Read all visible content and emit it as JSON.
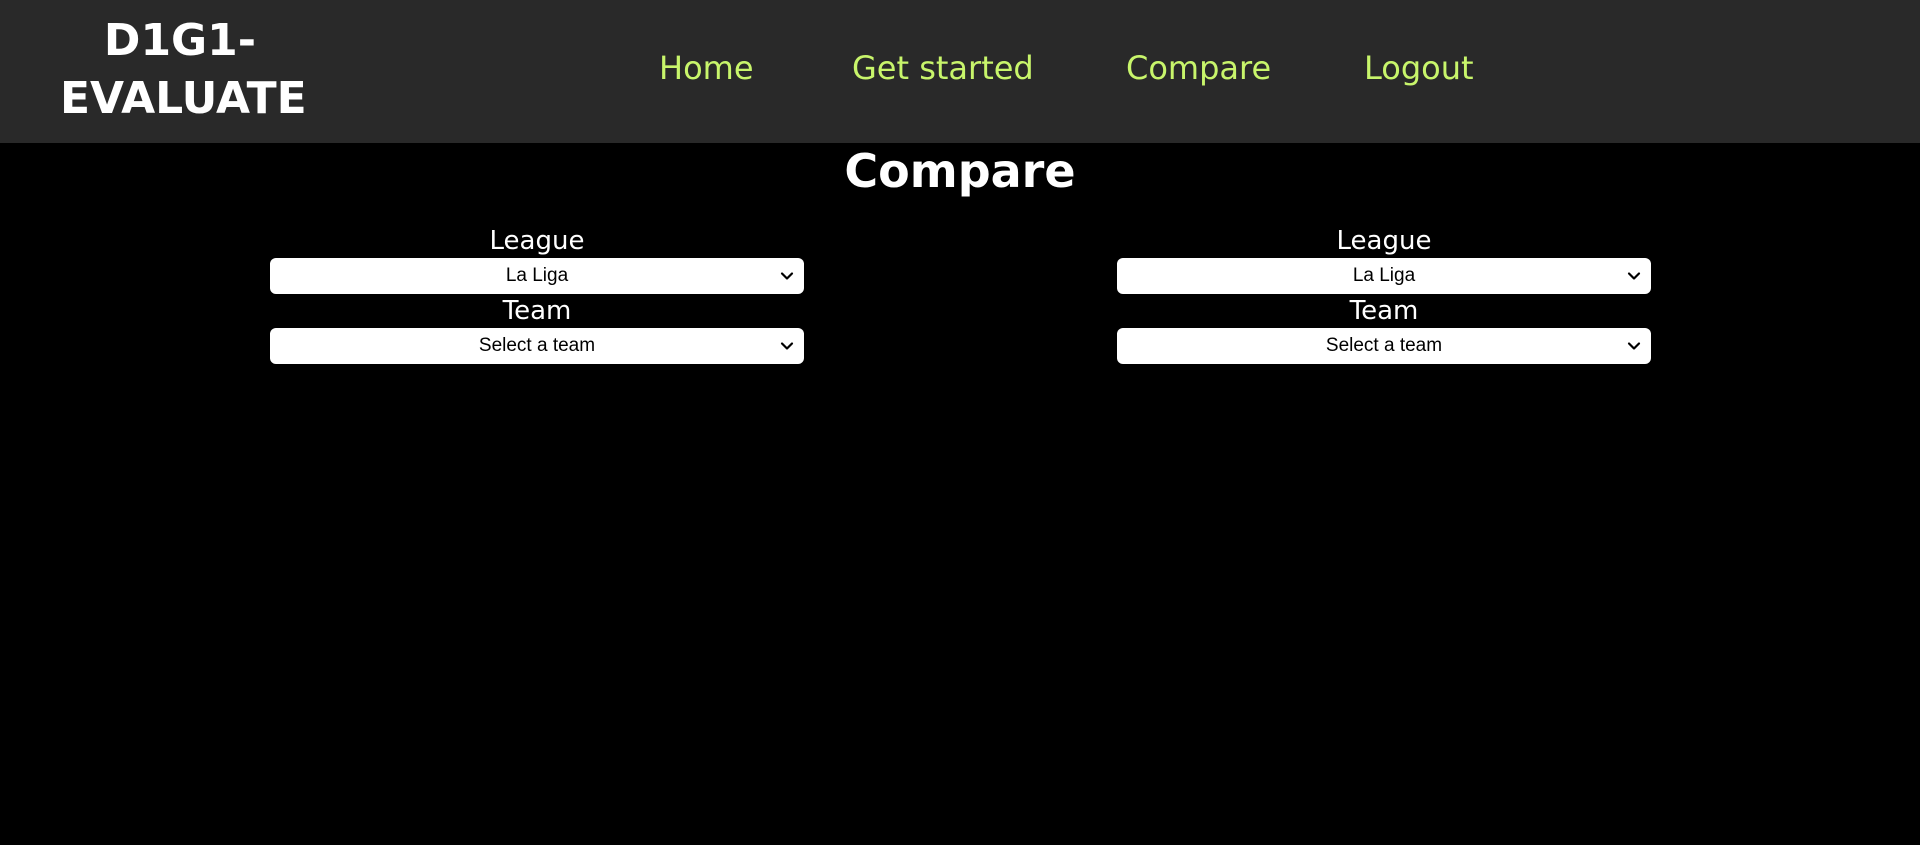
{
  "app": {
    "logo_line1": "D1G1-",
    "logo_line2": "EVALUATE"
  },
  "nav": {
    "items": [
      {
        "label": "Home"
      },
      {
        "label": "Get started"
      },
      {
        "label": "Compare"
      },
      {
        "label": "Logout"
      }
    ]
  },
  "page": {
    "title": "Compare"
  },
  "compare": {
    "left": {
      "league_label": "League",
      "league_value": "La Liga",
      "team_label": "Team",
      "team_value": "Select a team"
    },
    "right": {
      "league_label": "League",
      "league_value": "La Liga",
      "team_label": "Team",
      "team_value": "Select a team"
    }
  },
  "colors": {
    "background": "#000000",
    "navbar": "#292929",
    "nav_link": "#c8f56b",
    "text": "#ffffff",
    "select_bg": "#ffffff"
  },
  "icons": {
    "dropdown": "chevron-down-icon"
  }
}
